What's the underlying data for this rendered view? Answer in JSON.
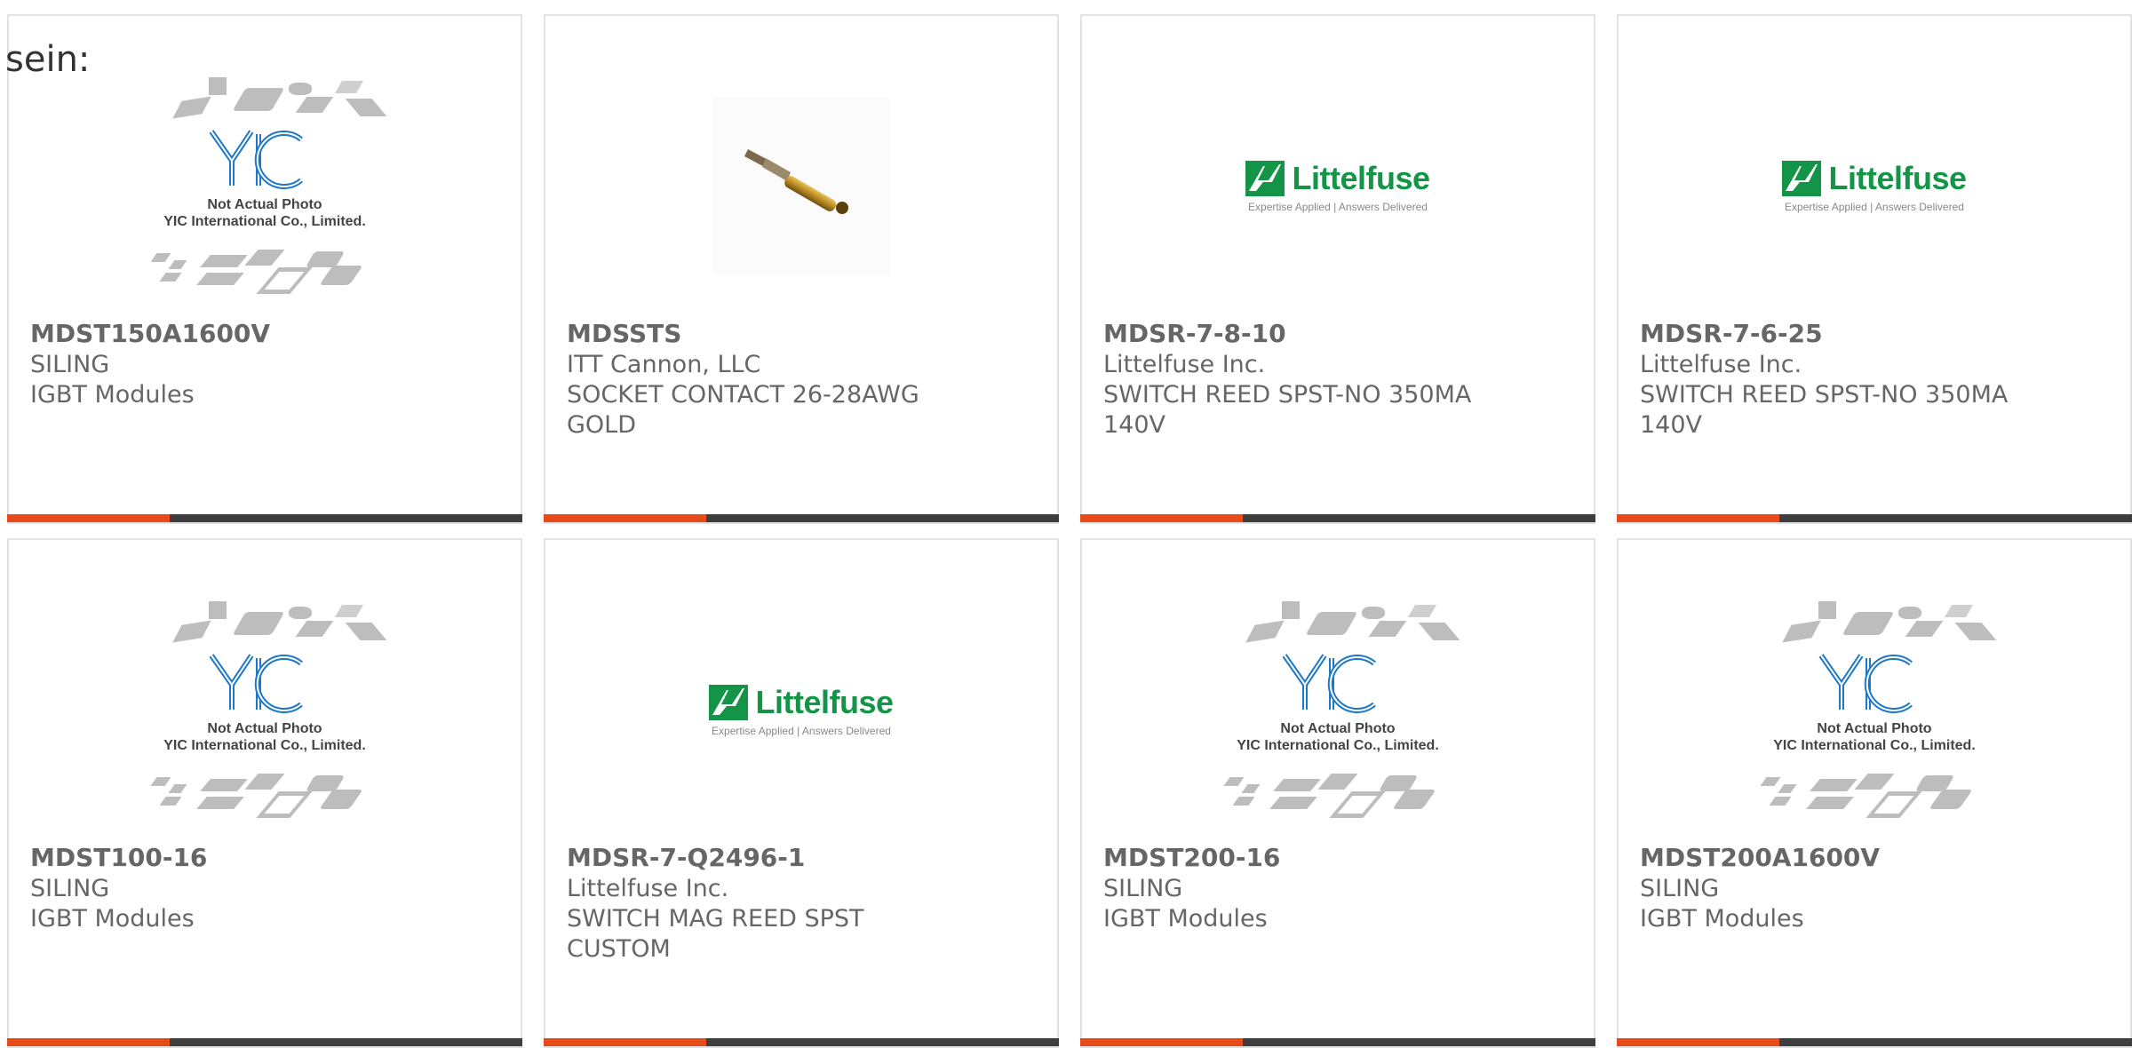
{
  "heading": "sein:",
  "colors": {
    "accent": "#e84b1a",
    "bar": "#3e3e3e",
    "littelfuse_green": "#149447",
    "yic_blue": "#1e78c8"
  },
  "placeholder": {
    "line1": "Not Actual Photo",
    "line2": "YIC International Co., Limited."
  },
  "littelfuse_logo": {
    "name": "Littelfuse",
    "tagline": "Expertise Applied | Answers Delivered"
  },
  "products": [
    {
      "part": "MDST150A1600V",
      "maker": "SILING",
      "desc": "IGBT Modules",
      "image": "yic-placeholder"
    },
    {
      "part": "MDSSTS",
      "maker": "ITT Cannon, LLC",
      "desc": "SOCKET CONTACT 26-28AWG\nGOLD",
      "image": "contact-pin-photo"
    },
    {
      "part": "MDSR-7-8-10",
      "maker": "Littelfuse Inc.",
      "desc": "SWITCH REED SPST-NO 350MA\n140V",
      "image": "littelfuse-logo"
    },
    {
      "part": "MDSR-7-6-25",
      "maker": "Littelfuse Inc.",
      "desc": "SWITCH REED SPST-NO 350MA\n140V",
      "image": "littelfuse-logo"
    },
    {
      "part": "MDST100-16",
      "maker": "SILING",
      "desc": "IGBT Modules",
      "image": "yic-placeholder"
    },
    {
      "part": "MDSR-7-Q2496-1",
      "maker": "Littelfuse Inc.",
      "desc": "SWITCH MAG REED SPST\nCUSTOM",
      "image": "littelfuse-logo"
    },
    {
      "part": "MDST200-16",
      "maker": "SILING",
      "desc": "IGBT Modules",
      "image": "yic-placeholder"
    },
    {
      "part": "MDST200A1600V",
      "maker": "SILING",
      "desc": "IGBT Modules",
      "image": "yic-placeholder"
    }
  ]
}
